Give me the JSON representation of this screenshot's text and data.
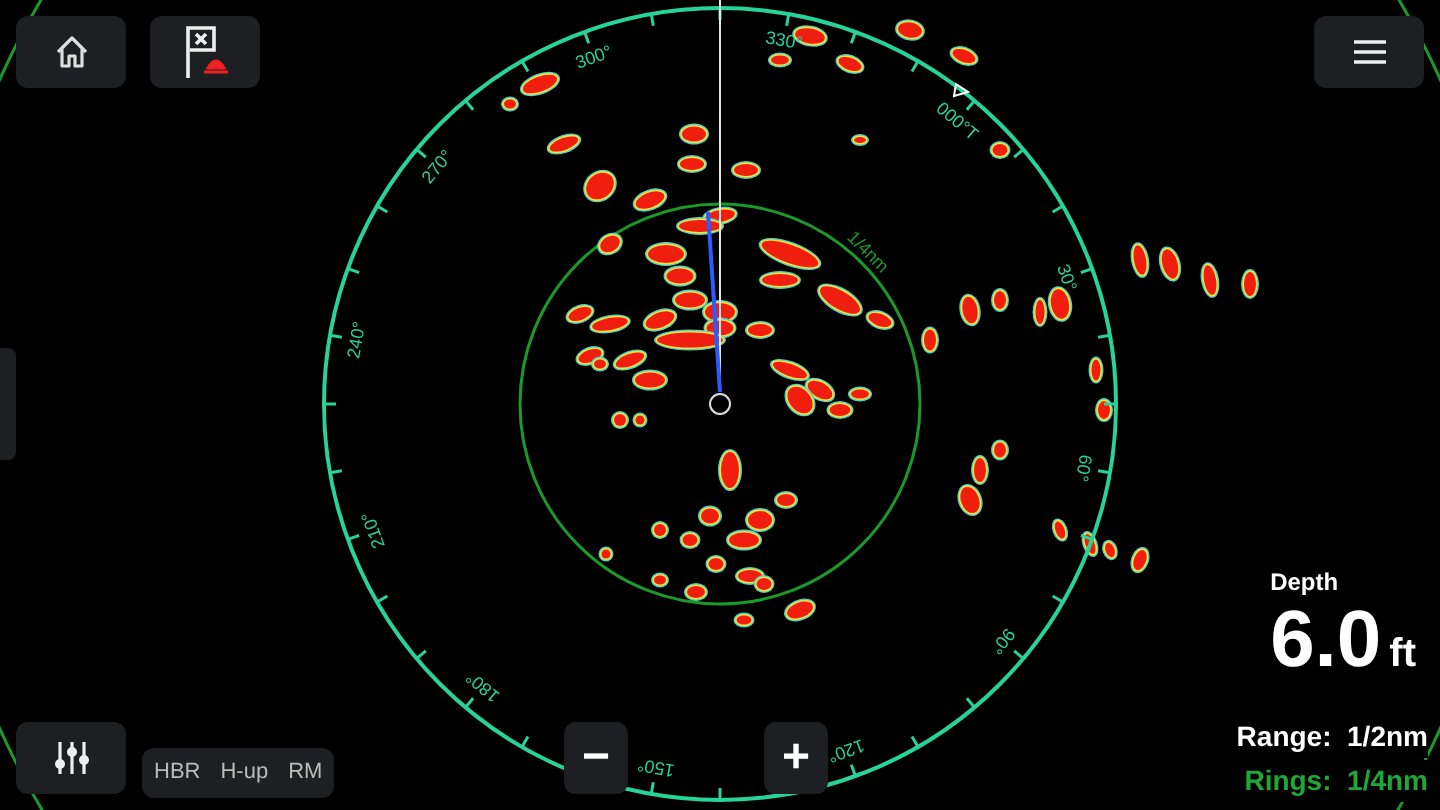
{
  "radar": {
    "bearing_labels": [
      "000°T",
      "30°",
      "60°",
      "90°",
      "120°",
      "150°",
      "180°",
      "210°",
      "240°",
      "270°",
      "300°",
      "330°"
    ],
    "range_ring_label": "1/4nm"
  },
  "mode_buttons": [
    "HBR",
    "H-up",
    "RM"
  ],
  "zoom": {
    "out": "−",
    "in": "+"
  },
  "depth": {
    "label": "Depth",
    "value": "6.0",
    "unit": "ft"
  },
  "range": "Range:  1/2nm",
  "rings": "Rings:  1/4nm"
}
